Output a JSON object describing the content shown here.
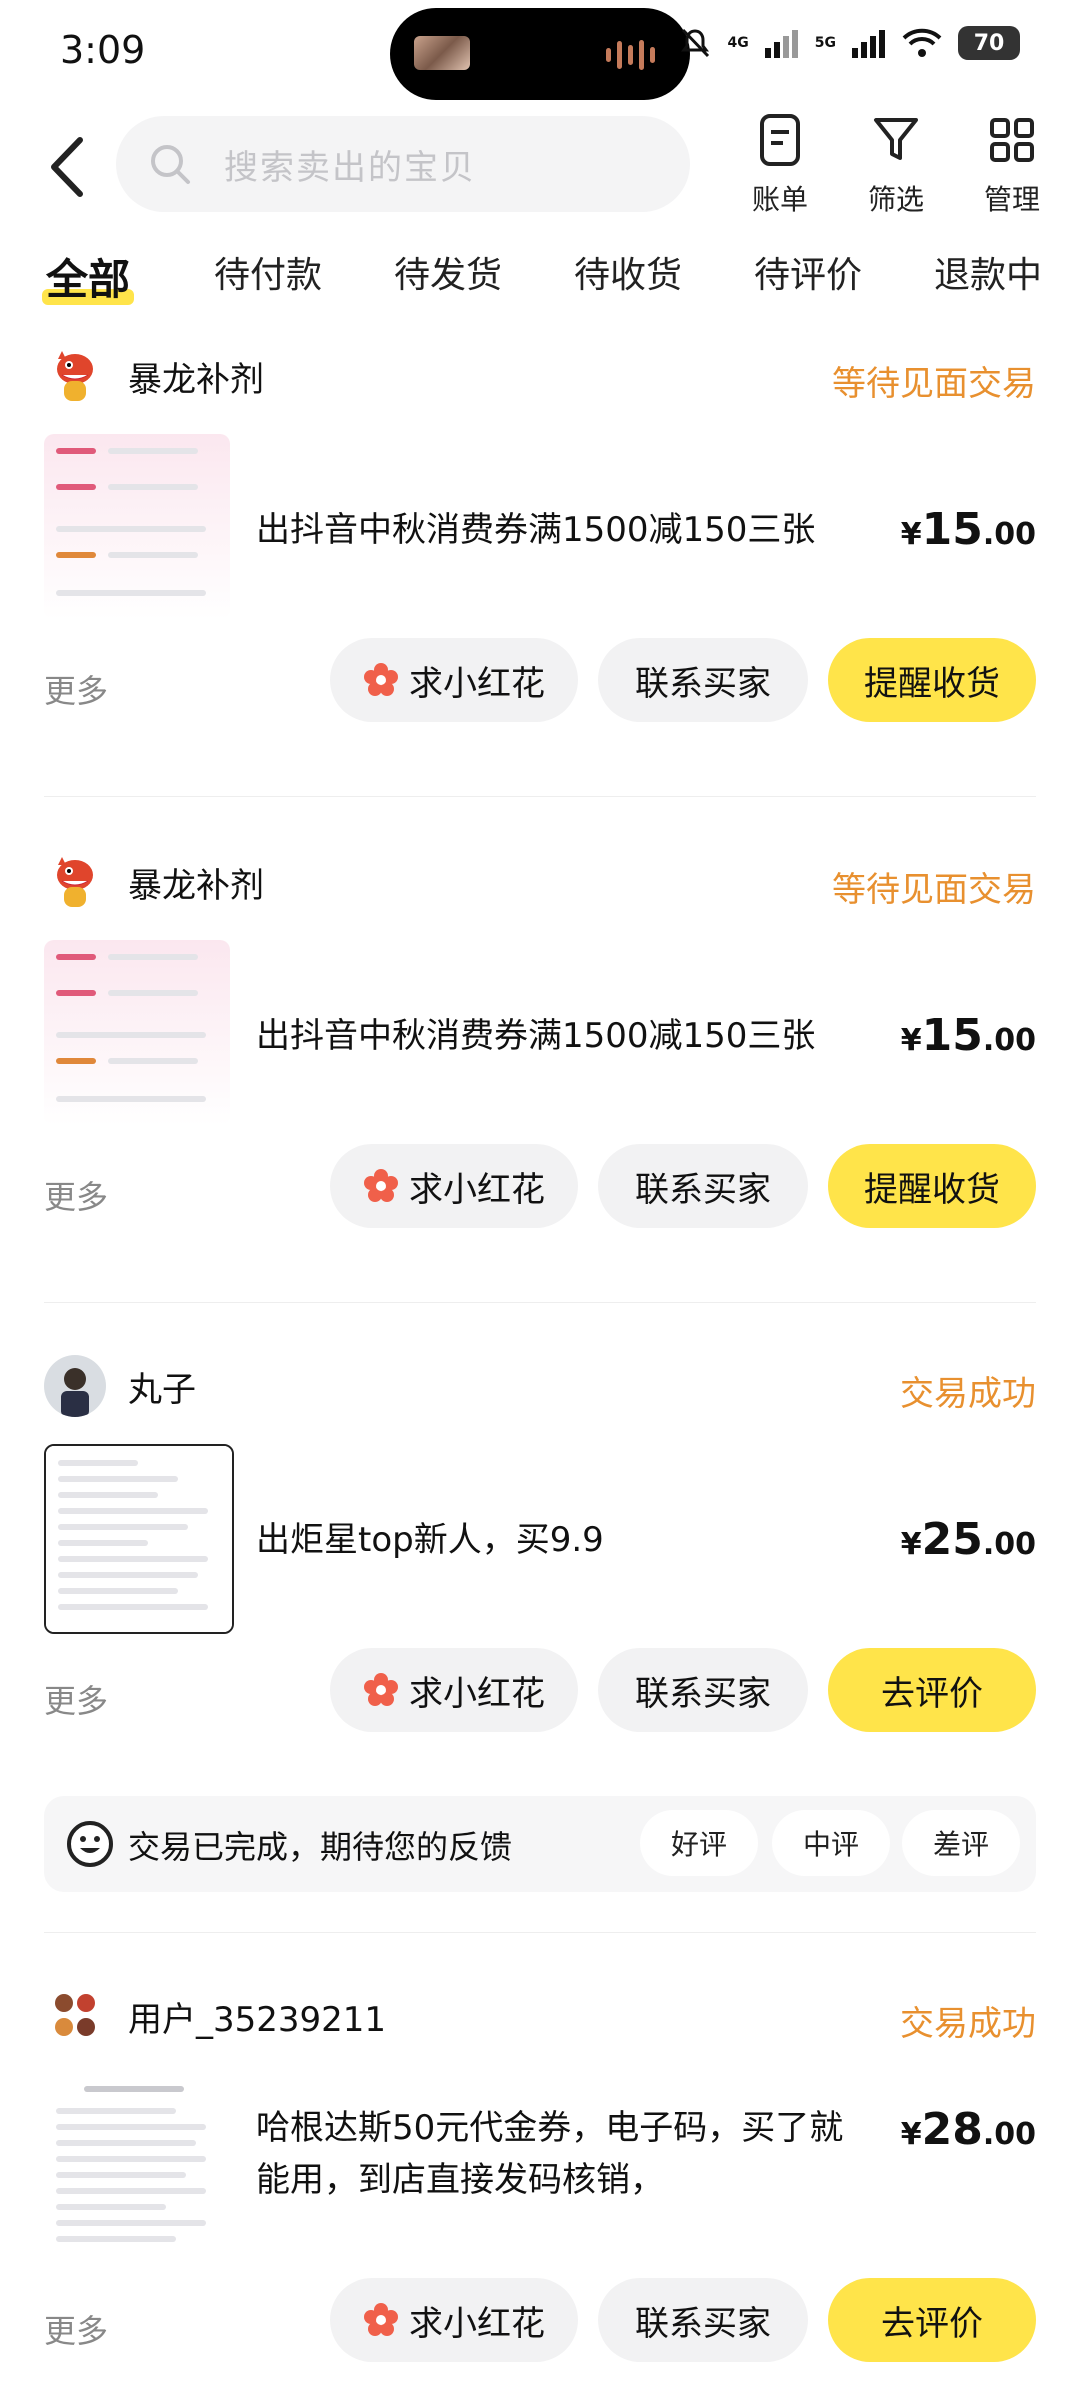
{
  "status_bar": {
    "time": "3:09",
    "net1": "4G",
    "net2": "5G",
    "battery": "70"
  },
  "header": {
    "search_placeholder": "搜索卖出的宝贝",
    "tools": [
      {
        "label": "账单",
        "icon": "bill-icon"
      },
      {
        "label": "筛选",
        "icon": "filter-icon"
      },
      {
        "label": "管理",
        "icon": "grid-icon"
      }
    ]
  },
  "tabs": [
    "全部",
    "待付款",
    "待发货",
    "待收货",
    "待评价",
    "退款中"
  ],
  "orders": [
    {
      "seller": "暴龙补剂",
      "status": "等待见面交易",
      "title": "出抖音中秋消费券满1500减150三张",
      "price_symbol": "¥",
      "price_int": "15",
      "price_dec": ".00",
      "more": "更多",
      "actions": [
        "求小红花",
        "联系买家",
        "提醒收货"
      ]
    },
    {
      "seller": "暴龙补剂",
      "status": "等待见面交易",
      "title": "出抖音中秋消费券满1500减150三张",
      "price_symbol": "¥",
      "price_int": "15",
      "price_dec": ".00",
      "more": "更多",
      "actions": [
        "求小红花",
        "联系买家",
        "提醒收货"
      ]
    },
    {
      "seller": "丸子",
      "status": "交易成功",
      "title": "出炬星top新人，买9.9",
      "price_symbol": "¥",
      "price_int": "25",
      "price_dec": ".00",
      "more": "更多",
      "actions": [
        "求小红花",
        "联系买家",
        "去评价"
      ],
      "feedback": {
        "message": "交易已完成，期待您的反馈",
        "options": [
          "好评",
          "中评",
          "差评"
        ]
      }
    },
    {
      "seller": "用户_35239211",
      "status": "交易成功",
      "title": "哈根达斯50元代金券，电子码，买了就能用，到店直接发码核销，",
      "price_symbol": "¥",
      "price_int": "28",
      "price_dec": ".00",
      "more": "更多",
      "actions": [
        "求小红花",
        "联系买家",
        "去评价"
      ]
    }
  ],
  "colors": {
    "accent_yellow": "#ffe44a",
    "status_orange": "#e8902f",
    "flower_red": "#f0604a"
  }
}
